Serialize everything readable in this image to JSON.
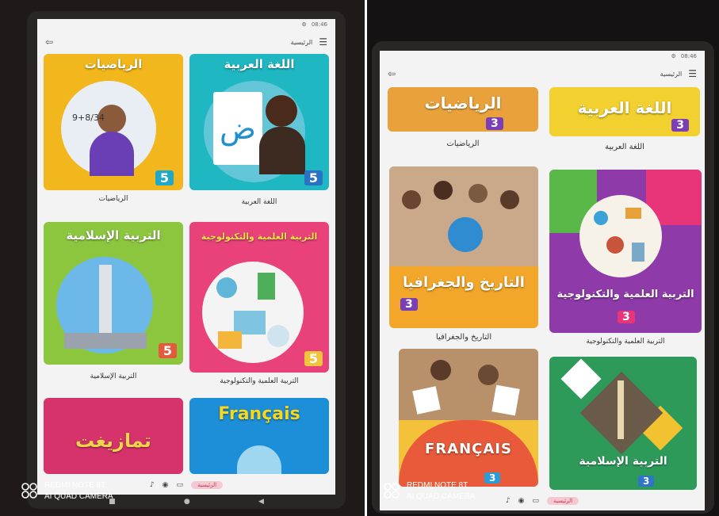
{
  "app": {
    "title": "الرئيسية",
    "status_time": "08:46",
    "exit_icon": "exit-icon",
    "menu_icon": "hamburger-icon",
    "settings_icon": "gear-icon"
  },
  "left": {
    "books": [
      {
        "label": "الرياضيات",
        "cover_title": "الرياضيات",
        "grade": "5",
        "color": "#f2b71c",
        "accent": "#5a3ea8"
      },
      {
        "label": "اللغة العربية",
        "cover_title": "اللغة العربية",
        "grade": "5",
        "color": "#1fb7c2",
        "accent": "#7c4a2a",
        "glyph": "ض"
      },
      {
        "label": "التربية الإسلامية",
        "cover_title": "التربية الإسلامية",
        "grade": "5",
        "color": "#8cc63f",
        "accent": "#2a8fd8"
      },
      {
        "label": "التربية العلمية والتكنولوجية",
        "cover_title": "التربية العلمية والتكنولوجية",
        "grade": "5",
        "color": "#e9427a",
        "accent": "#f1c43a"
      },
      {
        "label": "",
        "cover_title": "تمازيغت",
        "grade": "",
        "color": "#d6336c",
        "accent": "#f0d44c"
      },
      {
        "label": "",
        "cover_title": "Français",
        "grade": "",
        "color": "#1c8fd8",
        "accent": "#f7d81e"
      }
    ],
    "bottom_nav": {
      "home": "الرئيسية",
      "icons": [
        "bell-icon",
        "profile-icon",
        "folder-icon"
      ]
    }
  },
  "right": {
    "books": [
      {
        "label": "الرياضيات",
        "cover_title": "الرياضيات",
        "grade": "3",
        "color": "#e9a23b",
        "accent": "#7a3fb5"
      },
      {
        "label": "اللغة العربية",
        "cover_title": "اللغة العربية",
        "grade": "3",
        "color": "#f1d02f",
        "accent": "#7a3fb5"
      },
      {
        "label": "التاريخ والجغرافيا",
        "cover_title": "التاريخ والجغرافيا",
        "grade": "3",
        "color": "#f2a72a",
        "accent": "#2e74c7"
      },
      {
        "label": "التربية العلمية والتكنولوجية",
        "cover_title": "التربية العلمية والتكنولوجية",
        "grade": "3",
        "color": "#8e3aa8",
        "accent": "#f2c230"
      },
      {
        "label": "",
        "cover_title": "FRANÇAIS",
        "grade": "3",
        "color": "#e85a3a",
        "accent": "#2b9cd8"
      },
      {
        "label": "",
        "cover_title": "التربية الإسلامية",
        "grade": "3",
        "color": "#2e9a5a",
        "accent": "#f2c230"
      }
    ],
    "bottom_nav": {
      "home": "الرئيسية",
      "icons": [
        "bell-icon",
        "profile-icon",
        "folder-icon"
      ]
    }
  },
  "watermark": {
    "line1": "REDMI NOTE 8T",
    "line2": "AI QUAD CAMERA"
  }
}
